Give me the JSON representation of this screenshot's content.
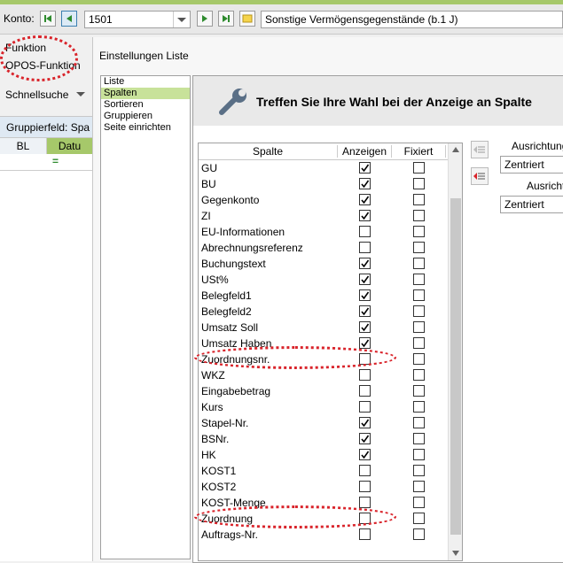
{
  "toolbar": {
    "konto_label": "Konto:",
    "konto_value": "1501",
    "konto_name": "Sonstige Vermögensgegenstände (b.1 J)"
  },
  "sidebar": {
    "funktion": "Funktion",
    "opos_funktion": "OPOS-Funktion",
    "schnellsuche": "Schnellsuche",
    "gruppierfeld": "Gruppierfeld: Spa",
    "col_bl": "BL",
    "col_datum": "Datu",
    "filter_symbol": "="
  },
  "dialog": {
    "title": "Einstellungen Liste",
    "nav_items": [
      "Liste",
      "Spalten",
      "Sortieren",
      "Gruppieren",
      "Seite einrichten"
    ],
    "nav_selected": 1,
    "banner_text": "Treffen Sie Ihre Wahl bei der Anzeige an Spalte",
    "table": {
      "headers": {
        "spalte": "Spalte",
        "anzeigen": "Anzeigen",
        "fixiert": "Fixiert"
      },
      "rows": [
        {
          "label": "GU",
          "anzeigen": true,
          "fixiert": false
        },
        {
          "label": "BU",
          "anzeigen": true,
          "fixiert": false
        },
        {
          "label": "Gegenkonto",
          "anzeigen": true,
          "fixiert": false
        },
        {
          "label": "ZI",
          "anzeigen": true,
          "fixiert": false
        },
        {
          "label": "EU-Informationen",
          "anzeigen": false,
          "fixiert": false
        },
        {
          "label": "Abrechnungsreferenz",
          "anzeigen": false,
          "fixiert": false
        },
        {
          "label": "Buchungstext",
          "anzeigen": true,
          "fixiert": false
        },
        {
          "label": "USt%",
          "anzeigen": true,
          "fixiert": false
        },
        {
          "label": "Belegfeld1",
          "anzeigen": true,
          "fixiert": false
        },
        {
          "label": "Belegfeld2",
          "anzeigen": true,
          "fixiert": false
        },
        {
          "label": "Umsatz Soll",
          "anzeigen": true,
          "fixiert": false
        },
        {
          "label": "Umsatz Haben",
          "anzeigen": true,
          "fixiert": false
        },
        {
          "label": "Zuordnungsnr.",
          "anzeigen": false,
          "fixiert": false
        },
        {
          "label": "WKZ",
          "anzeigen": false,
          "fixiert": false
        },
        {
          "label": "Eingabebetrag",
          "anzeigen": false,
          "fixiert": false
        },
        {
          "label": "Kurs",
          "anzeigen": false,
          "fixiert": false
        },
        {
          "label": "Stapel-Nr.",
          "anzeigen": true,
          "fixiert": false
        },
        {
          "label": "BSNr.",
          "anzeigen": true,
          "fixiert": false
        },
        {
          "label": "HK",
          "anzeigen": true,
          "fixiert": false
        },
        {
          "label": "KOST1",
          "anzeigen": false,
          "fixiert": false
        },
        {
          "label": "KOST2",
          "anzeigen": false,
          "fixiert": false
        },
        {
          "label": "KOST-Menge",
          "anzeigen": false,
          "fixiert": false
        },
        {
          "label": "Zuordnung",
          "anzeigen": false,
          "fixiert": false
        },
        {
          "label": "Auftrags-Nr.",
          "anzeigen": false,
          "fixiert": false
        }
      ]
    },
    "right": {
      "ausrichtung1_label": "Ausrichtung",
      "ausrichtung1_value": "Zentriert",
      "ausrichtung2_label": "Ausrichtu",
      "ausrichtung2_value": "Zentriert"
    }
  },
  "colors": {
    "accent": "#a6c86a",
    "annotation": "#d9242b",
    "selection": "#c8e29a"
  }
}
